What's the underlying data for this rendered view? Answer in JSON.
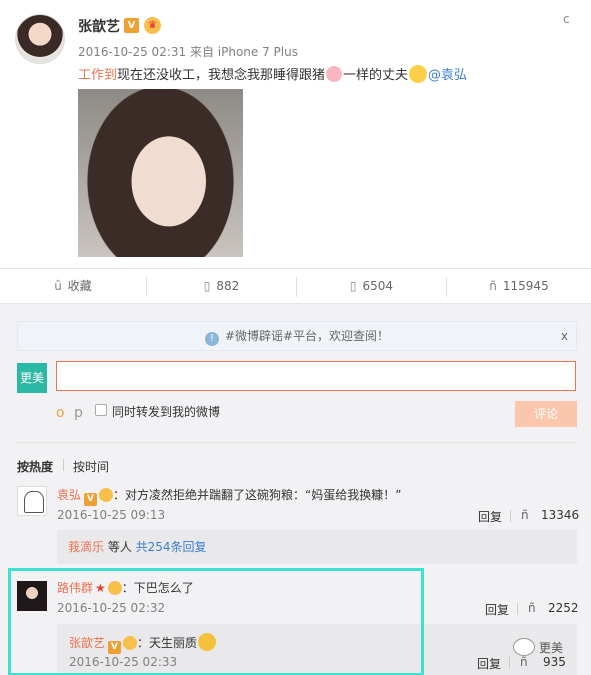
{
  "post": {
    "author": "张歆艺",
    "verified_badge": "V",
    "meta": "2016-10-25 02:31 来自 iPhone 7 Plus",
    "text": {
      "topic": "工作到",
      "part1": "现在还没收工，我想念我那睡得跟猪",
      "part2": "一样的丈夫",
      "mention": "@袁弘"
    },
    "menu_icon": "chevron-down-icon"
  },
  "actions": {
    "favorite": {
      "icon": "star-icon",
      "label": "收藏"
    },
    "repost": {
      "icon": "repost-icon",
      "count": "882"
    },
    "comment": {
      "icon": "comment-icon",
      "count": "6504"
    },
    "like": {
      "icon": "thumb-up-icon",
      "count": "115945"
    }
  },
  "comments_section": {
    "notice": "#微博辟谣#平台，欢迎查阅！",
    "notice_close": "x",
    "my_avatar_label": "更美",
    "input_value": "",
    "repost_label": "同时转发到我的微博",
    "submit_label": "评论",
    "sort_hot": "按热度",
    "sort_time": "按时间",
    "emoji_btn": "o",
    "pic_btn": "p"
  },
  "comments": [
    {
      "name": "袁弘",
      "text": "：对方凌然拒绝并踹翻了这碗狗粮：“妈蛋给我换糠！”",
      "time": "2016-10-25 09:13",
      "reply_label": "回复",
      "likes": "13346",
      "replies_summary": {
        "user": "莪滴乐",
        "mid": " 等人 ",
        "total": "共254条回复"
      }
    },
    {
      "name": "路伟群",
      "text": "：下巴怎么了",
      "time": "2016-10-25 02:32",
      "reply_label": "回复",
      "likes": "2252",
      "nested_reply": {
        "name": "张歆艺",
        "text": "：天生丽质",
        "time": "2016-10-25 02:33",
        "reply_label": "回复",
        "likes": "935"
      }
    }
  ],
  "watermark": "更美"
}
